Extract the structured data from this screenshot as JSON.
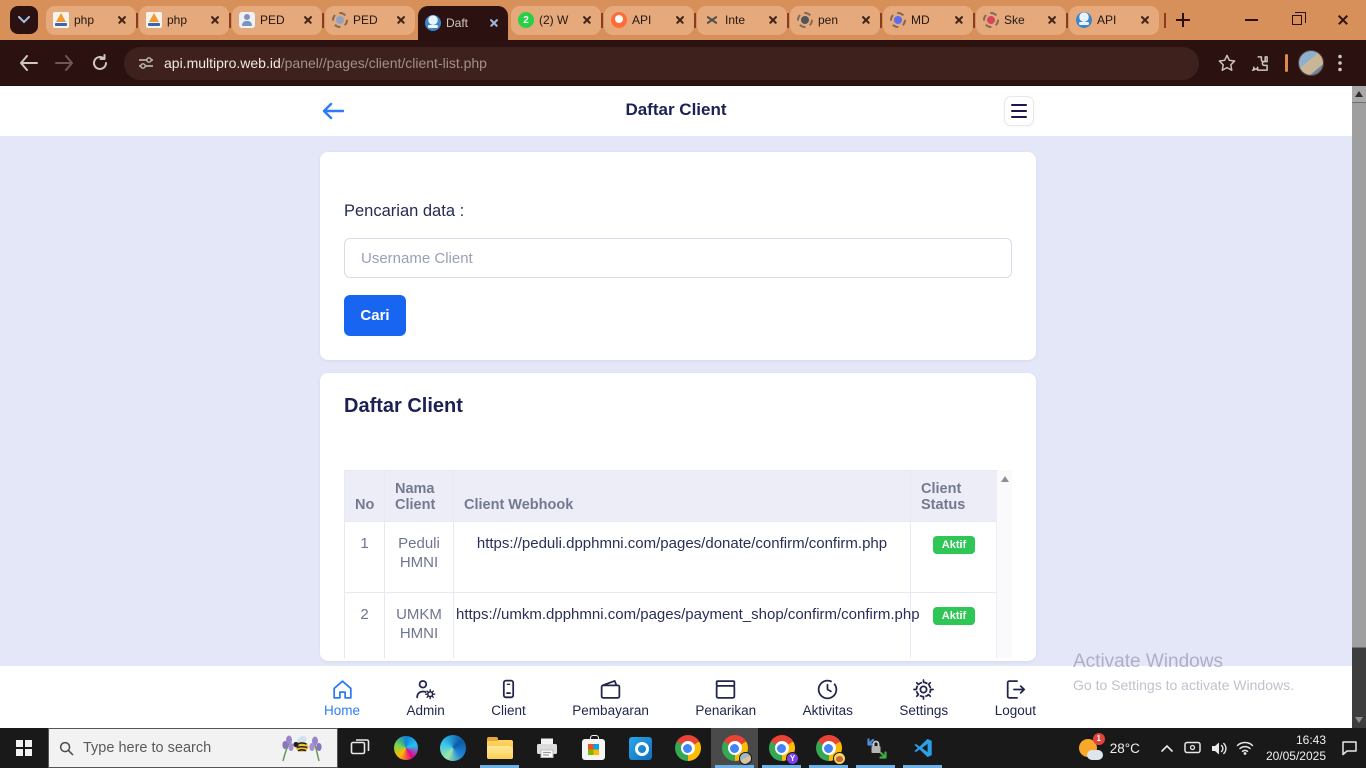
{
  "browser": {
    "tabs": [
      {
        "title": "php"
      },
      {
        "title": "php"
      },
      {
        "title": "PED"
      },
      {
        "title": "PED"
      },
      {
        "title": "Daft"
      },
      {
        "title": "(2) W",
        "badge": "2"
      },
      {
        "title": "API"
      },
      {
        "title": "Inte"
      },
      {
        "title": "pen"
      },
      {
        "title": "MD"
      },
      {
        "title": "Ske"
      },
      {
        "title": "API"
      }
    ],
    "url_host": "api.multipro.web.id",
    "url_path": "/panel//pages/client/client-list.php"
  },
  "page": {
    "header_title": "Daftar Client",
    "search_card": {
      "label": "Pencarian data :",
      "placeholder": "Username Client",
      "button_label": "Cari"
    },
    "table_card": {
      "title": "Daftar Client",
      "columns": {
        "no": "No",
        "name": "Nama Client",
        "webhook": "Client Webhook",
        "status": "Client Status"
      },
      "rows": [
        {
          "no": "1",
          "name": "Peduli HMNI",
          "webhook": "https://peduli.dpphmni.com/pages/donate/confirm/confirm.php",
          "status": "Aktif"
        },
        {
          "no": "2",
          "name": "UMKM HMNI",
          "webhook": "https://umkm.dpphmni.com/pages/payment_shop/confirm/confirm.php",
          "status": "Aktif"
        }
      ]
    },
    "nav": [
      {
        "label": "Home"
      },
      {
        "label": "Admin"
      },
      {
        "label": "Client"
      },
      {
        "label": "Pembayaran"
      },
      {
        "label": "Penarikan"
      },
      {
        "label": "Aktivitas"
      },
      {
        "label": "Settings"
      },
      {
        "label": "Logout"
      }
    ],
    "watermark": {
      "line1": "Activate Windows",
      "line2": "Go to Settings to activate Windows."
    }
  },
  "taskbar": {
    "search_placeholder": "Type here to search",
    "weather_temp": "28°C",
    "weather_badge": "1",
    "chrome_profile_letter": "Y",
    "time": "16:43",
    "date": "20/05/2025"
  },
  "colors": {
    "accent_blue": "#2e7bf6",
    "button_blue": "#1865f2",
    "badge_green": "#2ec655",
    "chrome_theme_orange": "#d8905a",
    "toolbar_dark": "#2b1210",
    "page_bg": "#e3e7f8",
    "navy": "#1b2153"
  }
}
